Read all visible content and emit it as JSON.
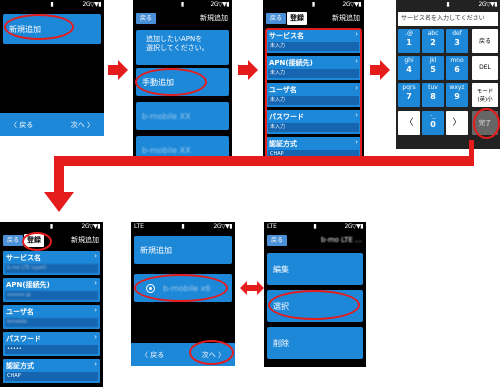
{
  "status": {
    "signal": "2G▽▼▮",
    "lte": "LTE",
    "mid_icon": "▮"
  },
  "common": {
    "back": "戻る",
    "register": "登録",
    "next": "次へ",
    "back_nav": "戻る",
    "unentered": "未入力"
  },
  "screen1": {
    "new_add": "新規追加",
    "back": "〈 戻る",
    "next": "次へ 〉"
  },
  "screen2": {
    "title": "新規追加",
    "instruction": "追加したいAPNを\n選択してください。",
    "manual": "手動追加",
    "item2": "b-mobile XX",
    "item3": "b-mobile XX"
  },
  "form": {
    "title": "新規追加",
    "fields": [
      {
        "label": "サービス名",
        "value": "未入力"
      },
      {
        "label": "APN(接続先)",
        "value": "未入力"
      },
      {
        "label": "ユーザ名",
        "value": "未入力"
      },
      {
        "label": "パスワード",
        "value": "未入力"
      },
      {
        "label": "認証方式",
        "value": "CHAP"
      }
    ]
  },
  "keyboard": {
    "prompt": "サービス名を入力してください",
    "keys": [
      {
        "t": ".@",
        "n": "1"
      },
      {
        "t": "abc",
        "n": "2"
      },
      {
        "t": "def",
        "n": "3"
      },
      {
        "t": "ghi",
        "n": "4"
      },
      {
        "t": "jkl",
        "n": "5"
      },
      {
        "t": "mno",
        "n": "6"
      },
      {
        "t": "pqrs",
        "n": "7"
      },
      {
        "t": "tuv",
        "n": "8"
      },
      {
        "t": "wxyz",
        "n": "9"
      }
    ],
    "side": [
      "戻る",
      "DEL",
      "モード\n(英)小",
      "完了"
    ],
    "left": "〈",
    "zero_t": "-_",
    "zero_n": "0",
    "right": "〉"
  },
  "filled": {
    "title": "新規追加",
    "fields": [
      {
        "label": "サービス名",
        "value": "b-mo LTE typeD"
      },
      {
        "label": "APN(接続先)",
        "value": "xxxxxx.jp"
      },
      {
        "label": "ユーザ名",
        "value": "bmobile"
      },
      {
        "label": "パスワード",
        "value": "•••••"
      },
      {
        "label": "認証方式",
        "value": "CHAP"
      }
    ]
  },
  "select": {
    "new_add": "新規追加",
    "apn": "b-mobile x6",
    "back": "〈 戻る",
    "next": "次へ 〉"
  },
  "menu": {
    "title": "b-mo LTE …",
    "edit": "編集",
    "select": "選択",
    "delete": "削除"
  },
  "colors": {
    "blue": "#1e88d8",
    "red": "#e51c1c"
  }
}
